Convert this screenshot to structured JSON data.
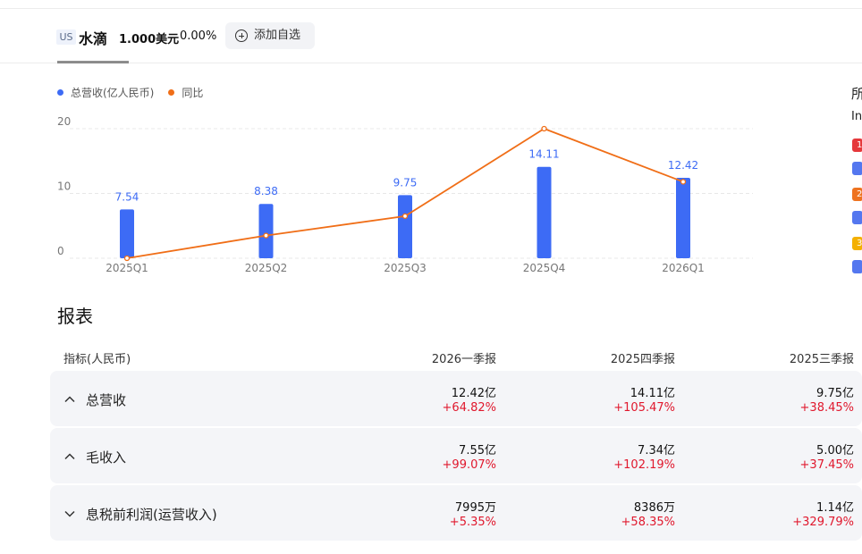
{
  "stock": {
    "market": "US",
    "name": "水滴",
    "price": "1.000美元",
    "change": "0.00%",
    "watch_label": "添加自选"
  },
  "legend": {
    "revenue": "总营收(亿人民币)",
    "yoy": "同比"
  },
  "colors": {
    "bar": "#3d6bf5",
    "line": "#f06e17",
    "positive": "#e0182d"
  },
  "chart_data": {
    "type": "bar",
    "categories": [
      "2025Q1",
      "2025Q2",
      "2025Q3",
      "2025Q4",
      "2026Q1"
    ],
    "series": [
      {
        "name": "总营收(亿人民币)",
        "values": [
          7.54,
          8.38,
          9.75,
          14.11,
          12.42
        ],
        "kind": "bar"
      },
      {
        "name": "同比",
        "values": [
          0.0,
          3.5,
          6.5,
          20.0,
          11.8
        ],
        "kind": "line"
      }
    ],
    "yticks": [
      "20",
      "10",
      "0"
    ],
    "ylim": [
      0,
      20
    ],
    "grid": true,
    "legend_position": "top-left"
  },
  "right_panel": {
    "line1": "所",
    "line2": "In",
    "badges": [
      "1",
      "2",
      "3"
    ]
  },
  "report": {
    "title": "报表",
    "headers": [
      "指标(人民币)",
      "2026一季报",
      "2025四季报",
      "2025三季报"
    ],
    "rows": [
      {
        "label": "总营收",
        "expanded": true,
        "values": [
          "12.42亿",
          "14.11亿",
          "9.75亿"
        ],
        "changes": [
          "+64.82%",
          "+105.47%",
          "+38.45%"
        ]
      },
      {
        "label": "毛收入",
        "expanded": true,
        "values": [
          "7.55亿",
          "7.34亿",
          "5.00亿"
        ],
        "changes": [
          "+99.07%",
          "+102.19%",
          "+37.45%"
        ]
      },
      {
        "label": "息税前利润(运营收入)",
        "expanded": false,
        "values": [
          "7995万",
          "8386万",
          "1.14亿"
        ],
        "changes": [
          "+5.35%",
          "+58.35%",
          "+329.79%"
        ]
      }
    ]
  }
}
